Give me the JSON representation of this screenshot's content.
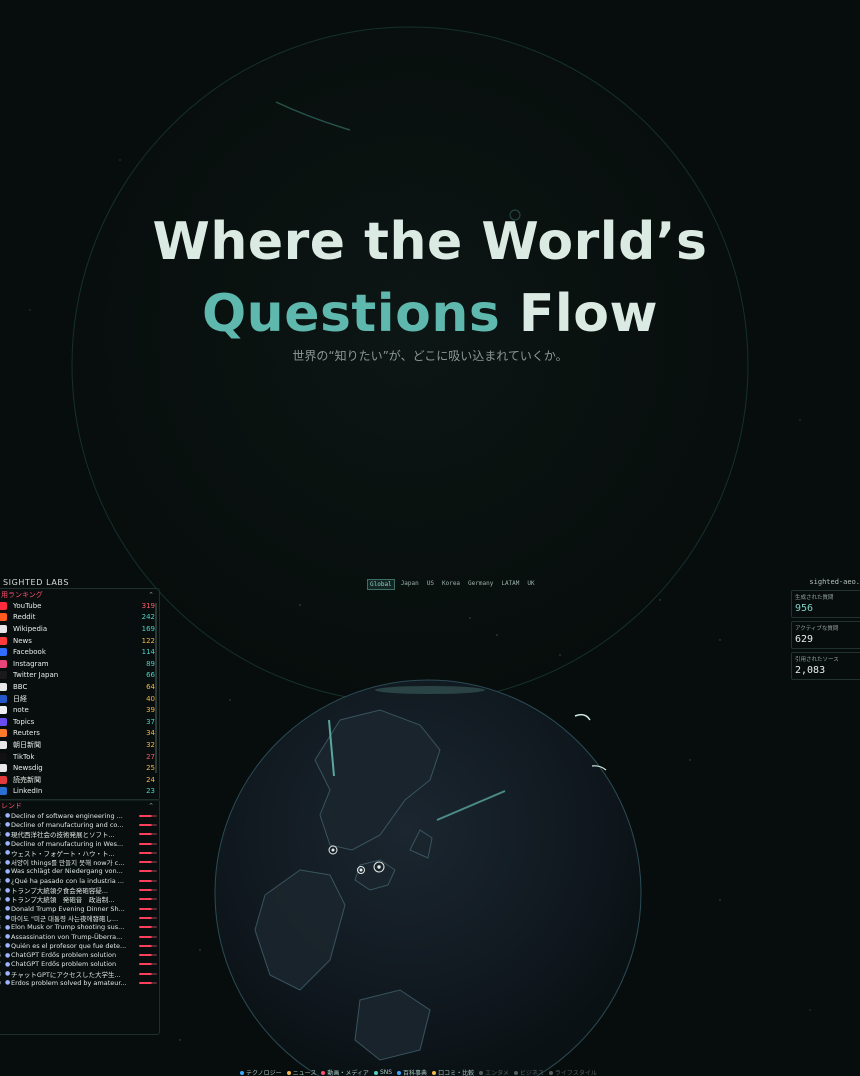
{
  "hero": {
    "line1": "Where the World’s",
    "line2_accent": "Questions",
    "line2_rest": "Flow",
    "subtitle": "世界の“知りたい”が、どこに吸い込まれていくか。"
  },
  "brand": "SIGHTED LABS",
  "site": "sighted-aeo.",
  "regions": {
    "active": "Global",
    "items": [
      "Global",
      "Japan",
      "US",
      "Korea",
      "Germany",
      "LATAM",
      "UK"
    ]
  },
  "ranking": {
    "title": "用ランキング",
    "items": [
      {
        "name": "YouTube",
        "value": "319",
        "color": "#ff2b3d",
        "valcolor": "#ff5a6d"
      },
      {
        "name": "Reddit",
        "value": "242",
        "color": "#ff5a1f",
        "valcolor": "#4fd1c5"
      },
      {
        "name": "Wikipedia",
        "value": "169",
        "color": "#e8e8e8",
        "valcolor": "#4fd1c5"
      },
      {
        "name": "News",
        "value": "122",
        "color": "#ff3b3b",
        "valcolor": "#f5b64a"
      },
      {
        "name": "Facebook",
        "value": "114",
        "color": "#2f6cff",
        "valcolor": "#4fd1c5"
      },
      {
        "name": "Instagram",
        "value": "89",
        "color": "#e8457a",
        "valcolor": "#4fd1c5"
      },
      {
        "name": "Twitter Japan",
        "value": "66",
        "color": "#1a1a1a",
        "valcolor": "#4fd1c5"
      },
      {
        "name": "BBC",
        "value": "64",
        "color": "#e8e8e8",
        "valcolor": "#f5b64a"
      },
      {
        "name": "日経",
        "value": "40",
        "color": "#2457c8",
        "valcolor": "#f5b64a"
      },
      {
        "name": "note",
        "value": "39",
        "color": "#f0f0f0",
        "valcolor": "#f5b64a"
      },
      {
        "name": "Topics",
        "value": "37",
        "color": "#6a4df0",
        "valcolor": "#4fd1c5"
      },
      {
        "name": "Reuters",
        "value": "34",
        "color": "#ff7a2a",
        "valcolor": "#f5b64a"
      },
      {
        "name": "朝日新聞",
        "value": "32",
        "color": "#e8e8e8",
        "valcolor": "#f5b64a"
      },
      {
        "name": "TikTok",
        "value": "27",
        "color": "#111111",
        "valcolor": "#ff5a6d"
      },
      {
        "name": "Newsdig",
        "value": "25",
        "color": "#e8e8e8",
        "valcolor": "#f5b64a"
      },
      {
        "name": "読売新聞",
        "value": "24",
        "color": "#e23a3a",
        "valcolor": "#f5b64a"
      },
      {
        "name": "LinkedIn",
        "value": "23",
        "color": "#2a6fd1",
        "valcolor": "#4fd1c5"
      }
    ]
  },
  "trends": {
    "title": "レンド",
    "items": [
      {
        "num": "1",
        "text": "Decline of software engineering ..."
      },
      {
        "num": "2",
        "text": "Decline of manufacturing and co..."
      },
      {
        "num": "3",
        "text": "現代西洋社会の技術発展とソフト..."
      },
      {
        "num": "4",
        "text": "Decline of manufacturing in Wes..."
      },
      {
        "num": "5",
        "text": "ウェスト・フォゲート・ハウ・ト..."
      },
      {
        "num": "6",
        "text": "서양이 things를 만들지 못해 now가 c..."
      },
      {
        "num": "7",
        "text": "Was schlägt der Niedergang von..."
      },
      {
        "num": "8",
        "text": "¿Qué ha pasado con la industria ..."
      },
      {
        "num": "9",
        "text": "トランプ大統領夕食会発砲容疑..."
      },
      {
        "num": "0",
        "text": "トランプ大統領　発砲音　政治制..."
      },
      {
        "num": "1",
        "text": "Donald Trump Evening Dinner Sh..."
      },
      {
        "num": "2",
        "text": "마이도 \"미군 대통령 사는夜에發砲し..."
      },
      {
        "num": "3",
        "text": "Elon Musk or Trump shooting sus..."
      },
      {
        "num": "4",
        "text": "Assassination von Trump-Überra..."
      },
      {
        "num": "5",
        "text": "Quién es el profesor que fue dete..."
      },
      {
        "num": "6",
        "text": "ChatGPT Erdős problem solution"
      },
      {
        "num": "7",
        "text": "ChatGPT Erdős problem solution"
      },
      {
        "num": "8",
        "text": "チャットGPTにアクセスした大学生..."
      },
      {
        "num": "9",
        "text": "Erdos problem solved by amateur..."
      }
    ]
  },
  "stats": [
    {
      "label": "生成された質問",
      "value": "956",
      "teal": true
    },
    {
      "label": "アクティブな質問",
      "value": "629",
      "teal": false
    },
    {
      "label": "引用されたソース",
      "value": "2,083",
      "teal": false
    }
  ],
  "categories": [
    {
      "label": "テクノロジー",
      "color": "#3aa8ff",
      "dim": false
    },
    {
      "label": "ニュース",
      "color": "#f5b64a",
      "dim": false
    },
    {
      "label": "動画・メディア",
      "color": "#ff4f6e",
      "dim": false
    },
    {
      "label": "SNS",
      "color": "#4fd1c5",
      "dim": false
    },
    {
      "label": "百科事典",
      "color": "#3aa8ff",
      "dim": false
    },
    {
      "label": "口コミ・比較",
      "color": "#f5b64a",
      "dim": false
    },
    {
      "label": "エンタメ",
      "color": "#4f605c",
      "dim": true
    },
    {
      "label": "ビジネス",
      "color": "#4f605c",
      "dim": true
    },
    {
      "label": "ライフスタイル",
      "color": "#4f605c",
      "dim": true
    }
  ]
}
